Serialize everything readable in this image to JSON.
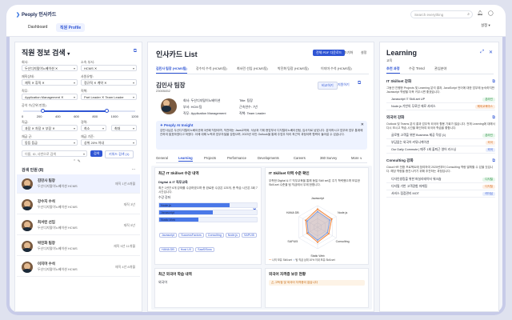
{
  "app": {
    "name": "Peoply 인사카드",
    "nav": [
      "Dashboard",
      "직원 Profile"
    ]
  },
  "top": {
    "search_placeholder": "Search everything",
    "setting": "설정"
  },
  "left": {
    "title": "직원 정보 검색",
    "chevron": "▾",
    "f1_label": "회사:",
    "f1_val": "두산디지털이노베이션 ✕",
    "f2_label": "소속 부서:",
    "f2_val": "HCMS ✕",
    "f3_label": "재직상태:",
    "f3_val": "재직 ✕ 휴직 ✕",
    "f4_label": "사원유형:",
    "f4_val": "정규직 ✕ 계약 ✕",
    "f5_label": "직무:",
    "f5_val": "Application Management ✕",
    "f6_label": "직책:",
    "f6_val": "Part Leader ✕ Team Leader",
    "slider_label": "공석 수(단위 만원)",
    "slider_ticks": [
      "0",
      "200",
      "400",
      "600",
      "800",
      "1000",
      "1200"
    ],
    "f7_label": "직급:",
    "f7_val": "과장 ✕ 차장 ✕ 부장 ✕",
    "f8_label": "경력:",
    "f8_from": "최소",
    "f8_to": "최대",
    "f9_label": "채급 군:",
    "f9_val": "동등 등급",
    "f10_label": "채급 기준:",
    "f10_val": "상위 20% 이내",
    "search_input": "이름, ID, 사번으로 검색",
    "search_btn": "검색",
    "alt_btn": "키워드 검색 (1)",
    "results_title": "검색 인원 (8)",
    "more": "...",
    "people": [
      {
        "name": "김민사 팀장",
        "org": "두산디지털이노베이션 HCMS",
        "meta": "재직 1년 8개월"
      },
      {
        "name": "강수지 수석",
        "org": "두산디지털이노베이션 HCMS",
        "meta": "재직 3년"
      },
      {
        "name": "최서린 선임",
        "org": "두산디지털이노베이션 HCMS",
        "meta": "재직 5년"
      },
      {
        "name": "박진화 팀장",
        "org": "두산디지털이노베이션 HCMS",
        "meta": "재직 5년 11개월"
      },
      {
        "name": "이지마 수석",
        "org": "두산디지털이노베이션 HCMS",
        "meta": "재직 4년 8개월"
      }
    ]
  },
  "center": {
    "title": "인사카드 List",
    "btn_pdf": "전체 PDF 다운로드",
    "btn_view": "조기화",
    "btn_set": "설정",
    "tabs": [
      "김민사 팀장 (HCMS팀)",
      "강수지 수석 (HCMS팀)",
      "최서린 선임 (HCMS팀)",
      "박진화 팀장 (HCMS팀)",
      "이지마 수석 (HCMS팀)"
    ],
    "person_name": "김민사 팀장",
    "person_id": "23005452",
    "btn_cmp": "비교하기",
    "btn_reg": "지원하기",
    "info": [
      [
        "회사: 두산디지털이노베이션",
        "Title: 팀장"
      ],
      [
        "부서: HCM 팀",
        "근속연수: 7년"
      ],
      [
        "직무: Application Management",
        "직책: Team Leader"
      ]
    ],
    "ai_title": "Peoply AI Insight",
    "ai_text": "김민사님은 두산디지털이노베이션에 3년째 직장이며, 직전에는 Java교의와, 삭상과 기제 현업부서 디지털이노베이션팀, 입사자로 남았니다. 분석하시고 업무와 업무 통계에 관하여 발표하였다고 하였다. 이에 대해 노력과 업무자질을 갖췄으며, 2023년 이인 Outlook을 통해 주업무 처리 최근의 과정이며 협력이 들어갈 수 있습니다.",
    "ptabs": [
      "General",
      "Learning",
      "Projects",
      "Performance",
      "Developments",
      "Careers",
      "360 Survey",
      "More ∨"
    ],
    "c1_title": "최근 IT Skillset 수강 내역",
    "c1_sub": "Digital & IT 직무교육",
    "c1_text": "최근 1년간 6개 강좌를 수강하였으며 총 완료한 수강은 125개, 총 학습 시간은 3회 7시간입니다.",
    "c1_label": "수강 강좌",
    "bars": [
      {
        "name": "Node.js",
        "v": 0.72
      },
      {
        "name": "Javascript",
        "v": 0.55
      },
      {
        "name": "Static Web",
        "v": 0.4
      }
    ],
    "tags": [
      "Javascript",
      "SuccessFactors",
      "Consulting",
      "Node.js",
      "SAPUI5",
      "HANA DB",
      "Host UX",
      "SaaS/Scss"
    ],
    "c2_title": "IT Skillset 이력 수준 확인",
    "c2_text": "우측한 Digital & IT 직무교육을 통해 동일 Skill set은 주기 학력했으며 보유한 Skill-set 수준을 팀 직급에서 무제 한합니다.",
    "chart_data": {
      "type": "radar",
      "categories": [
        "Javascript",
        "Node.js",
        "Consulting",
        "Static Web",
        "SAPUI5",
        "HANA DB"
      ],
      "series": [
        {
          "name": "나의 보유 Skill-set",
          "values": [
            4.2,
            3.8,
            3.0,
            3.5,
            2.8,
            3.2
          ]
        },
        {
          "name": "팀 직급 상위 10% 이내 보유 Skill-set",
          "values": [
            3.6,
            3.3,
            2.6,
            3.0,
            2.5,
            2.8
          ]
        }
      ],
      "max": 5,
      "colors": [
        "#f07a2a",
        "#6a9bef"
      ]
    },
    "c3_title": "최근 외국어 학습 내역",
    "c3_sub": "외국어",
    "c4_title": "외국어 자격증 보유 현황",
    "c4_text": "고득점 및 외국어 자격증이 없습니다"
  },
  "right": {
    "title": "Learning",
    "sub": "교육",
    "tabs": [
      "추천 과정",
      "수강 Trend",
      "관심분야"
    ],
    "s1_title": "IT Skillset 강화",
    "s1_text": "그동안 진행한 Projects 및 Learning 분석 결과, JavaScript 언어에 대한 업무에 능숙하지만 Javascript 역량을 더욱 키우시면 좋겠습니다.",
    "s1_items": [
      {
        "name": "Javascript IT Skill-set UP",
        "tag": "온라인"
      },
      {
        "name": "Node.js 기반의 무료인 애로 서비스",
        "tag": "해외교육마스"
      }
    ],
    "s2_title": "외국어 강화",
    "s2_text": "Outlook 및 Teams 분석 결과 업무적 외국어 활용 기회가 많습니다. 전체 Learning에 대해서 다시 보시고 학습 시간을 확인하여 외국어 학습을 좋합니다.",
    "s2_items": [
      {
        "name": "글로벌 고객을 위한 Business 제공 작성 (1)",
        "tag": "온라인"
      },
      {
        "name": "부담없는 외국어 커뮤니케이션",
        "tag": "외국"
      },
      {
        "name": "Our Daily Commute | 매주 1회 출퇴근 영어 리스닝",
        "tag": "외국"
      }
    ],
    "s3_title": "Consulting 강화",
    "s3_text": "Cloud HR 전환 프로젝트에 참여하여 2020년부터 Consulting 역량 발휘할 수 있을 것입니다. 해당 역량을 증진시키기 위해 추천하는 과정입니다.",
    "s3_items": [
      {
        "name": "디자인씽킹을 위한 퍼실리테이터 워크숍",
        "tag": "디지털"
      },
      {
        "name": "다지털 기반 고객경험 마케팅",
        "tag": "디지털"
      },
      {
        "name": "서비스 접점관리 MOT",
        "tag": "리더십"
      }
    ]
  }
}
